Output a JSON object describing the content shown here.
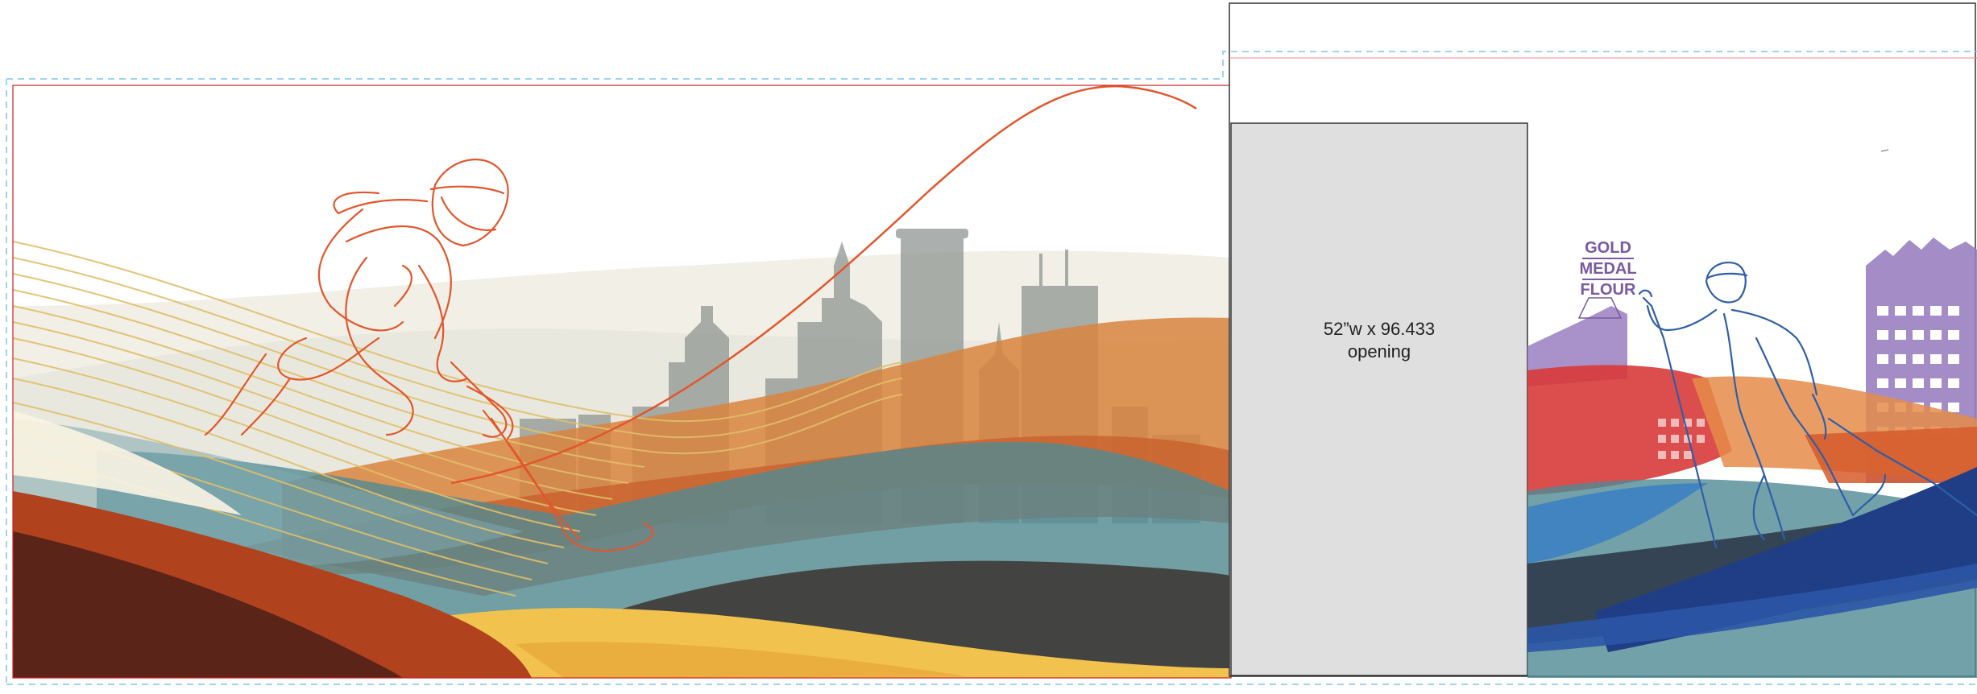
{
  "opening_label": {
    "line1": "52”w x 96.433",
    "line2": "opening"
  },
  "sign": {
    "line1": "GOLD",
    "line2": "MEDAL",
    "line3": "FLOUR"
  },
  "colors": {
    "guide": "#9fd3f0",
    "trim": "#cc2222",
    "sky": "#ffffff",
    "skyline": "#8f9693",
    "orange_line": "#e2562c",
    "amber": "#d9843e",
    "teal": "#4f8a94",
    "dark_brown": "#5a2418",
    "rust": "#b0431e",
    "yellow": "#f1c24d",
    "charcoal": "#3e3a36",
    "opening_panel": "#dfdfdf",
    "right_blue": "#1f3e86",
    "right_red": "#d83a3a",
    "right_purple": "#9a7fc0"
  },
  "icons": [
    "hockey-player-line-icon",
    "skier-line-icon",
    "city-skyline-icon"
  ]
}
